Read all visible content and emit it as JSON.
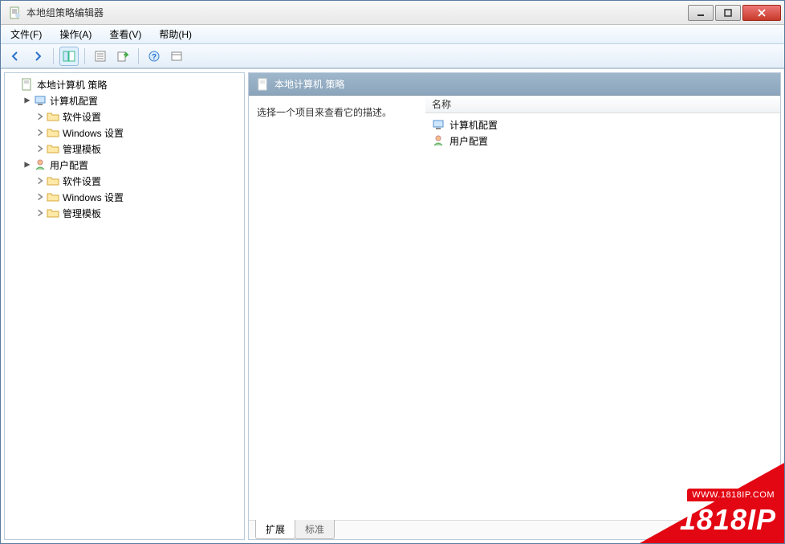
{
  "window": {
    "title": "本地组策略编辑器"
  },
  "menubar": {
    "file": "文件(F)",
    "action": "操作(A)",
    "view": "查看(V)",
    "help": "帮助(H)"
  },
  "tree": {
    "root": "本地计算机 策略",
    "computer": "计算机配置",
    "user": "用户配置",
    "software": "软件设置",
    "windows": "Windows 设置",
    "admin": "管理模板"
  },
  "detail": {
    "title": "本地计算机 策略",
    "description": "选择一个项目来查看它的描述。",
    "nameHeader": "名称",
    "items": {
      "computer": "计算机配置",
      "user": "用户配置"
    }
  },
  "tabs": {
    "extended": "扩展",
    "standard": "标准"
  },
  "watermark": {
    "url": "WWW.1818IP.COM",
    "brand": "1818IP"
  }
}
